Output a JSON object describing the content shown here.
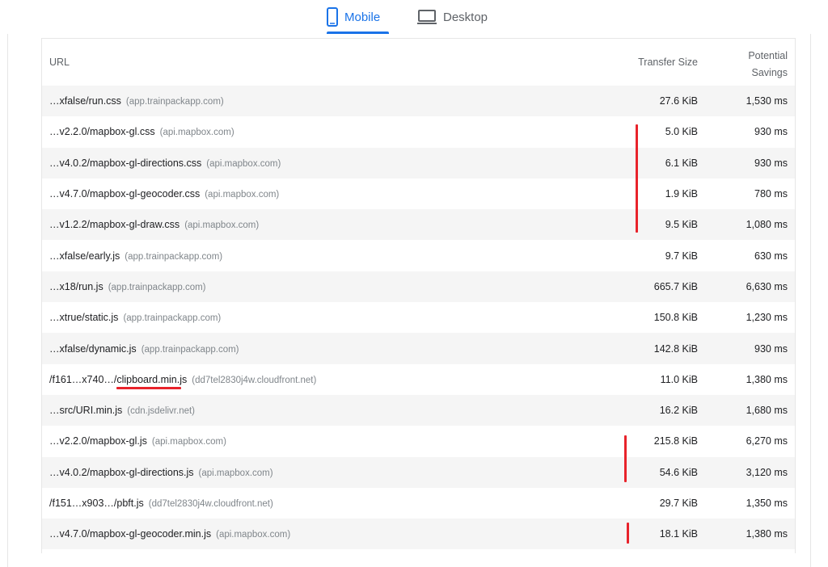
{
  "tabs": [
    {
      "label": "Mobile",
      "icon": "phone-icon",
      "active": true
    },
    {
      "label": "Desktop",
      "icon": "monitor-icon",
      "active": false
    }
  ],
  "table": {
    "headers": {
      "url": "URL",
      "transfer_size": "Transfer Size",
      "savings_line1": "Potential",
      "savings_line2": "Savings"
    },
    "rows": [
      {
        "path": "…xfalse/run.css",
        "host": "(app.trainpackapp.com)",
        "size": "27.6 KiB",
        "savings": "1,530 ms"
      },
      {
        "path": "…v2.2.0/mapbox-gl.css",
        "host": "(api.mapbox.com)",
        "size": "5.0 KiB",
        "savings": "930 ms"
      },
      {
        "path": "…v4.0.2/mapbox-gl-directions.css",
        "host": "(api.mapbox.com)",
        "size": "6.1 KiB",
        "savings": "930 ms"
      },
      {
        "path": "…v4.7.0/mapbox-gl-geocoder.css",
        "host": "(api.mapbox.com)",
        "size": "1.9 KiB",
        "savings": "780 ms"
      },
      {
        "path": "…v1.2.2/mapbox-gl-draw.css",
        "host": "(api.mapbox.com)",
        "size": "9.5 KiB",
        "savings": "1,080 ms"
      },
      {
        "path": "…xfalse/early.js",
        "host": "(app.trainpackapp.com)",
        "size": "9.7 KiB",
        "savings": "630 ms"
      },
      {
        "path": "…x18/run.js",
        "host": "(app.trainpackapp.com)",
        "size": "665.7 KiB",
        "savings": "6,630 ms"
      },
      {
        "path": "…xtrue/static.js",
        "host": "(app.trainpackapp.com)",
        "size": "150.8 KiB",
        "savings": "1,230 ms"
      },
      {
        "path": "…xfalse/dynamic.js",
        "host": "(app.trainpackapp.com)",
        "size": "142.8 KiB",
        "savings": "930 ms"
      },
      {
        "path": "/f161…x740…/clipboard.min.js",
        "host": "(dd7tel2830j4w.cloudfront.net)",
        "size": "11.0 KiB",
        "savings": "1,380 ms"
      },
      {
        "path": "…src/URI.min.js",
        "host": "(cdn.jsdelivr.net)",
        "size": "16.2 KiB",
        "savings": "1,680 ms"
      },
      {
        "path": "…v2.2.0/mapbox-gl.js",
        "host": "(api.mapbox.com)",
        "size": "215.8 KiB",
        "savings": "6,270 ms"
      },
      {
        "path": "…v4.0.2/mapbox-gl-directions.js",
        "host": "(api.mapbox.com)",
        "size": "54.6 KiB",
        "savings": "3,120 ms"
      },
      {
        "path": "/f151…x903…/pbft.js",
        "host": "(dd7tel2830j4w.cloudfront.net)",
        "size": "29.7 KiB",
        "savings": "1,350 ms"
      },
      {
        "path": "…v4.7.0/mapbox-gl-geocoder.min.js",
        "host": "(api.mapbox.com)",
        "size": "18.1 KiB",
        "savings": "1,380 ms"
      }
    ]
  },
  "annotation_color": "#e8232b",
  "accent_color": "#1a73e8"
}
